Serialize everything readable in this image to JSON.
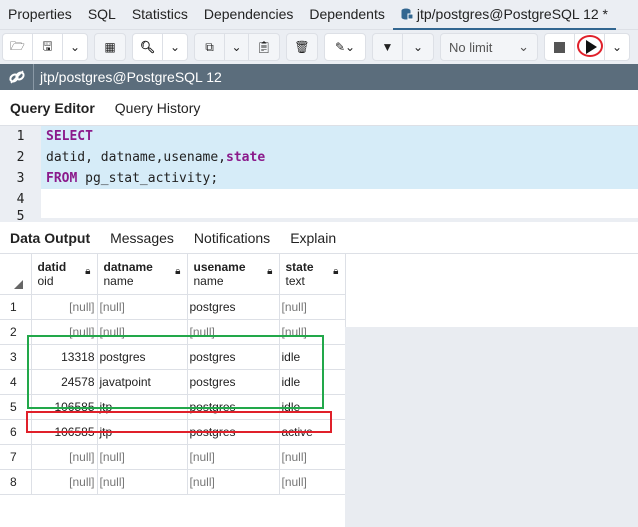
{
  "tabs": [
    {
      "label": "Properties"
    },
    {
      "label": "SQL"
    },
    {
      "label": "Statistics"
    },
    {
      "label": "Dependencies"
    },
    {
      "label": "Dependents"
    },
    {
      "label": "jtp/postgres@PostgreSQL 12 *",
      "icon": "database-icon",
      "active": true
    }
  ],
  "toolbar": {
    "limit_label": "No limit"
  },
  "connection": {
    "label": "jtp/postgres@PostgreSQL 12"
  },
  "query_tabs": [
    "Query Editor",
    "Query History"
  ],
  "editor": {
    "lines": [
      {
        "num": "1",
        "kw": "SELECT",
        "rest": ""
      },
      {
        "num": "2",
        "pre": "datid, datname,usename,",
        "kw2": "state"
      },
      {
        "num": "3",
        "kw": "FROM",
        "rest": " pg_stat_activity;"
      },
      {
        "num": "4"
      },
      {
        "num": "5"
      }
    ]
  },
  "output_tabs": [
    "Data Output",
    "Messages",
    "Notifications",
    "Explain"
  ],
  "columns": [
    {
      "name": "datid",
      "type": "oid"
    },
    {
      "name": "datname",
      "type": "name"
    },
    {
      "name": "usename",
      "type": "name"
    },
    {
      "name": "state",
      "type": "text"
    }
  ],
  "rows": [
    {
      "n": "1",
      "datid": "[null]",
      "datname": "[null]",
      "usename": "postgres",
      "state": "[null]"
    },
    {
      "n": "2",
      "datid": "[null]",
      "datname": "[null]",
      "usename": "[null]",
      "state": "[null]"
    },
    {
      "n": "3",
      "datid": "13318",
      "datname": "postgres",
      "usename": "postgres",
      "state": "idle"
    },
    {
      "n": "4",
      "datid": "24578",
      "datname": "javatpoint",
      "usename": "postgres",
      "state": "idle"
    },
    {
      "n": "5",
      "datid": "106585",
      "datname": "jtp",
      "usename": "postgres",
      "state": "idle"
    },
    {
      "n": "6",
      "datid": "106585",
      "datname": "jtp",
      "usename": "postgres",
      "state": "active"
    },
    {
      "n": "7",
      "datid": "[null]",
      "datname": "[null]",
      "usename": "[null]",
      "state": "[null]"
    },
    {
      "n": "8",
      "datid": "[null]",
      "datname": "[null]",
      "usename": "[null]",
      "state": "[null]"
    }
  ],
  "annotations": {
    "green_box_color": "#22a84a",
    "red_box_color": "#e0202a"
  }
}
